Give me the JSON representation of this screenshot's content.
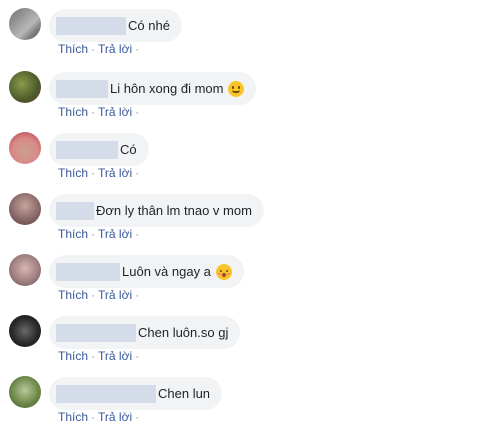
{
  "action_labels": {
    "like": "Thích",
    "reply": "Trả lời",
    "separator": "·"
  },
  "comments": [
    {
      "text": "Có nhé"
    },
    {
      "text": "Li hôn xong đi mom"
    },
    {
      "text": "Có"
    },
    {
      "text": "Đơn ly thân lm tnao v mom"
    },
    {
      "text": "Luôn và ngay a"
    },
    {
      "text": "Chen luôn.so gj"
    },
    {
      "text": "Chen lun"
    }
  ],
  "colors": {
    "bubble": "#f2f3f5",
    "link": "#385898",
    "name_blur": "#d0d9e8"
  }
}
